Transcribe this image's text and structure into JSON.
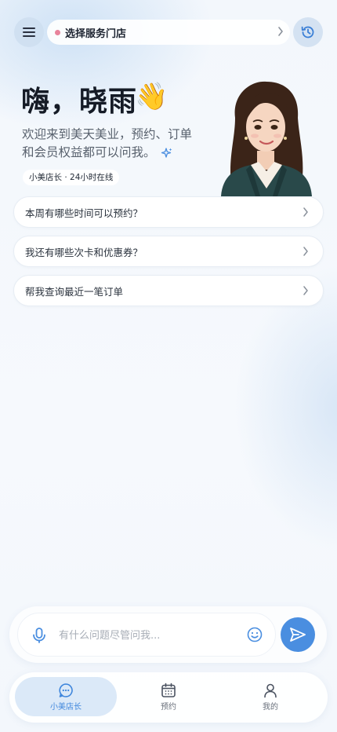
{
  "header": {
    "store_label": "选择服务门店",
    "store_dot_color": "#e8839b"
  },
  "hero": {
    "greeting": "嗨，晓雨",
    "wave_emoji": "👋",
    "intro_line1": "欢迎来到美天美业，预约、订单",
    "intro_line2": "和会员权益都可以问我。",
    "badge": "小美店长 · 24小时在线"
  },
  "suggestions": [
    {
      "label": "本周有哪些时间可以预约？"
    },
    {
      "label": "我还有哪些次卡和优惠券？"
    },
    {
      "label": "帮我查询最近一笔订单"
    }
  ],
  "composer": {
    "placeholder": "有什么问题尽管问我..."
  },
  "tabs": [
    {
      "label": "小美店长",
      "icon": "chat-icon",
      "active": true
    },
    {
      "label": "预约",
      "icon": "calendar-icon",
      "active": false
    },
    {
      "label": "我的",
      "icon": "user-icon",
      "active": false
    }
  ],
  "colors": {
    "accent": "#4a8ee0",
    "tab_active_bg": "#dbe9f8"
  }
}
